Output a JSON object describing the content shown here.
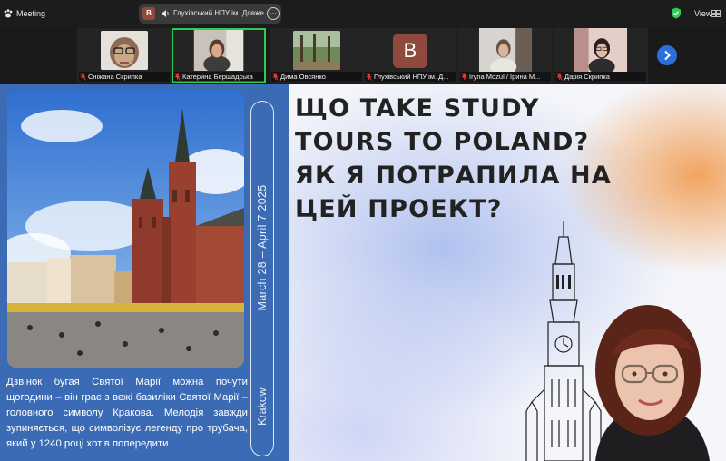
{
  "topbar": {
    "meeting_title": "Meeting",
    "share_badge": "B",
    "share_name": "Глухівський НПУ ім. Довже",
    "more_label": "···",
    "view_label": "View"
  },
  "participants": [
    {
      "name": "Сніжана Скрипка"
    },
    {
      "name": "Катерина Бершадська"
    },
    {
      "name": "Дима Овсянко"
    },
    {
      "name": "Глухівський НПУ ім. Д...",
      "avatar_letter": "B"
    },
    {
      "name": "Iryna Mozul / Ірина М..."
    },
    {
      "name": "Дарія Скрипка"
    }
  ],
  "slide": {
    "headline_lines": [
      "ЩО TAKE STUDY",
      "TOURS TO POLAND?",
      "ЯК Я ПОТРАПИЛА НА",
      "ЦЕЙ ПРОЕКТ?"
    ],
    "dates": "March 28 – April 7   2025",
    "city": "Krakow",
    "description": "Дзвінок бугая Святої Марії можна почути щогодини – він грає з вежі базиліки Святої Марії – головного символу Кракова. Мелодія завжди зупиняється, що символізує легенду про трубача, який у 1240 році хотів попередити"
  },
  "colors": {
    "slide_blue": "#3c6bb5",
    "active_speaker": "#2ecc55",
    "accent_blue": "#2a6fdb",
    "badge_brown": "#8f4a3d"
  },
  "icons": [
    "zoom-paw-icon",
    "speaker-icon",
    "more-icon",
    "security-shield-icon",
    "view-grid-icon",
    "mic-muted-icon",
    "chevron-right-icon"
  ]
}
